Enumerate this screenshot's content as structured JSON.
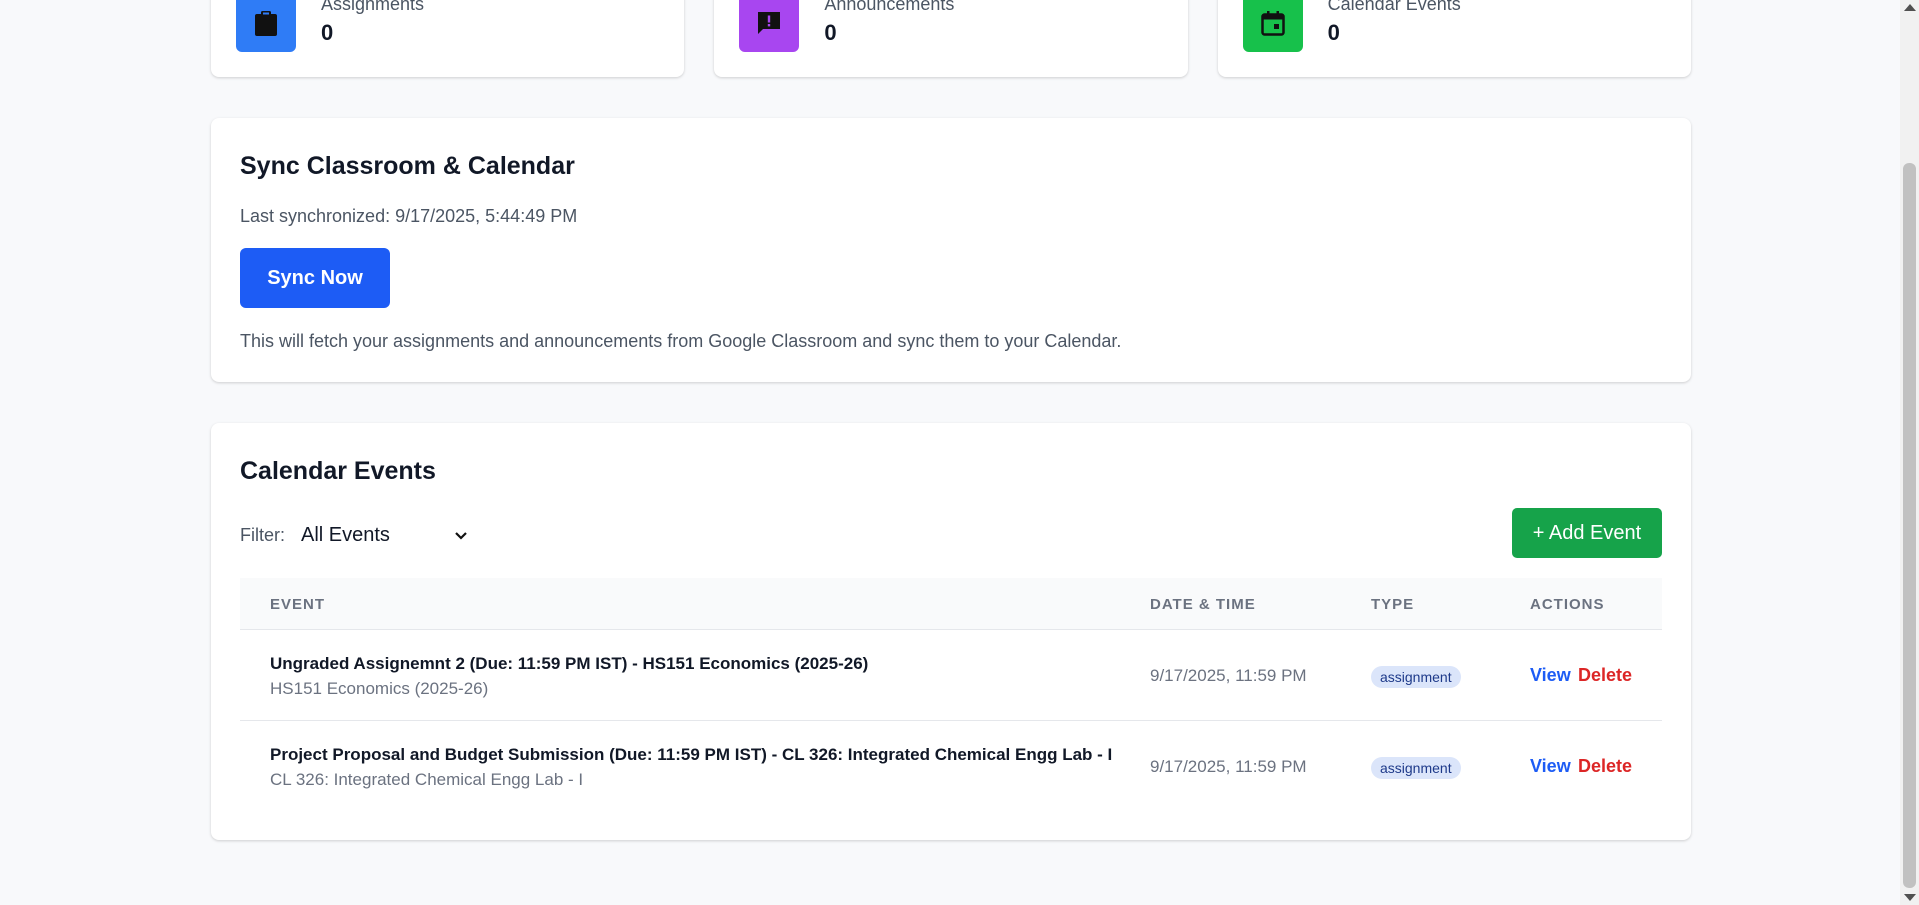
{
  "stats": [
    {
      "label": "Assignments",
      "value": "0",
      "color": "#2f7cf6",
      "icon": "clipboard-icon"
    },
    {
      "label": "Announcements",
      "value": "0",
      "color": "#a846f0",
      "icon": "chat-alert-icon"
    },
    {
      "label": "Calendar Events",
      "value": "0",
      "color": "#17c14b",
      "icon": "calendar-icon"
    }
  ],
  "sync": {
    "title": "Sync Classroom & Calendar",
    "last_synced": "Last synchronized: 9/17/2025, 5:44:49 PM",
    "button_label": "Sync Now",
    "description": "This will fetch your assignments and announcements from Google Classroom and sync them to your Calendar."
  },
  "events": {
    "title": "Calendar Events",
    "filter_label": "Filter:",
    "filter_value": "All Events",
    "add_button": "+ Add Event",
    "columns": [
      "EVENT",
      "DATE & TIME",
      "TYPE",
      "ACTIONS"
    ],
    "rows": [
      {
        "title": "Ungraded Assignemnt 2 (Due: 11:59 PM IST) - HS151 Economics (2025-26)",
        "course": "HS151 Economics (2025-26)",
        "datetime": "9/17/2025, 11:59 PM",
        "type": "assignment",
        "view": "View",
        "delete": "Delete"
      },
      {
        "title": "Project Proposal and Budget Submission (Due: 11:59 PM IST) - CL 326: Integrated Chemical Engg Lab - I",
        "course": "CL 326: Integrated Chemical Engg Lab - I",
        "datetime": "9/17/2025, 11:59 PM",
        "type": "assignment",
        "view": "View",
        "delete": "Delete"
      }
    ]
  },
  "colors": {
    "primary": "#1d5cf5",
    "success": "#16a34a",
    "danger": "#dc2626"
  }
}
